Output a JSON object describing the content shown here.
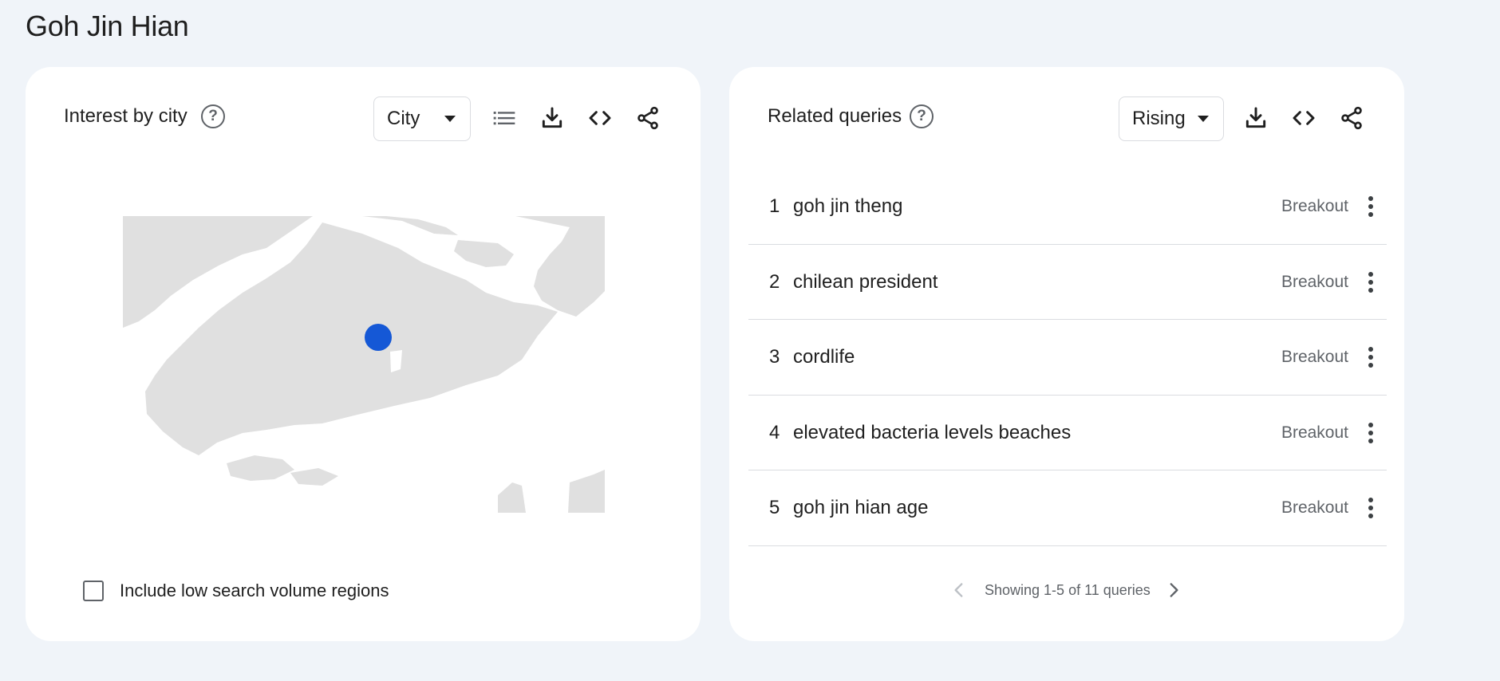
{
  "page": {
    "title": "Goh Jin Hian"
  },
  "interest_by_city": {
    "title": "Interest by city",
    "help_glyph": "?",
    "select_value": "City",
    "low_volume_label": "Include low search volume regions",
    "map": {
      "region": "Singapore",
      "land_color": "#e0e0e0",
      "marker_color": "#1558d6",
      "markers": 1
    }
  },
  "related_queries": {
    "title": "Related queries",
    "help_glyph": "?",
    "select_value": "Rising",
    "items": [
      {
        "rank": "1",
        "query": "goh jin theng",
        "value": "Breakout"
      },
      {
        "rank": "2",
        "query": "chilean president",
        "value": "Breakout"
      },
      {
        "rank": "3",
        "query": "cordlife",
        "value": "Breakout"
      },
      {
        "rank": "4",
        "query": "elevated bacteria levels beaches",
        "value": "Breakout"
      },
      {
        "rank": "5",
        "query": "goh jin hian age",
        "value": "Breakout"
      }
    ],
    "pager_text": "Showing 1-5 of 11 queries"
  },
  "icons": {
    "help": "help-circle-icon",
    "list": "list-view-icon",
    "download": "download-icon",
    "embed": "code-embed-icon",
    "share": "share-icon",
    "more": "more-vert-icon",
    "prev": "chevron-left-icon",
    "next": "chevron-right-icon"
  },
  "colors": {
    "background": "#f0f4f9",
    "card": "#ffffff",
    "accent": "#1558d6",
    "muted": "#5f6368"
  }
}
